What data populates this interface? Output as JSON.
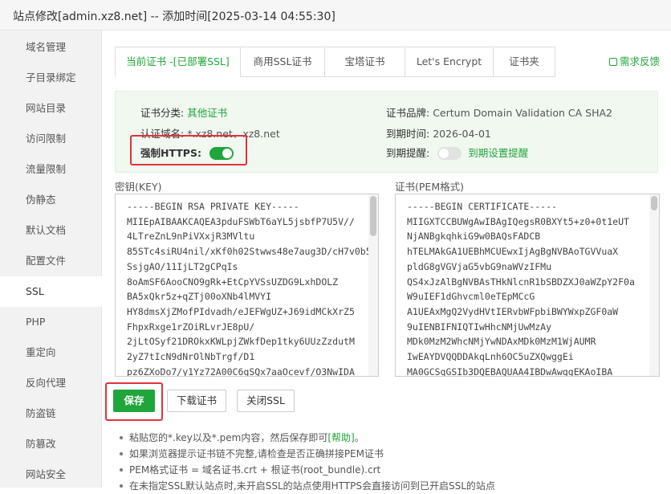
{
  "window": {
    "title": "站点修改[admin.xz8.net] -- 添加时间[2025-03-14 04:55:30]"
  },
  "sidebar": {
    "items": [
      {
        "label": "域名管理"
      },
      {
        "label": "子目录绑定"
      },
      {
        "label": "网站目录"
      },
      {
        "label": "访问限制"
      },
      {
        "label": "流量限制"
      },
      {
        "label": "伪静态"
      },
      {
        "label": "默认文档"
      },
      {
        "label": "配置文件"
      },
      {
        "label": "SSL",
        "active": true
      },
      {
        "label": "PHP"
      },
      {
        "label": "重定向"
      },
      {
        "label": "反向代理"
      },
      {
        "label": "防盗链"
      },
      {
        "label": "防篡改"
      },
      {
        "label": "网站安全"
      }
    ]
  },
  "tabs": [
    {
      "label": "当前证书 -[已部署SSL]",
      "active": true
    },
    {
      "label": "商用SSL证书"
    },
    {
      "label": "宝塔证书"
    },
    {
      "label": "Let's Encrypt"
    },
    {
      "label": "证书夹"
    }
  ],
  "feedback": {
    "label": "需求反馈",
    "icon": "feedback-icon"
  },
  "cert_info": {
    "category_label": "证书分类:",
    "category_value": "其他证书",
    "domain_label": "认证域名:",
    "domain_value": "*.xz8.net、xz8.net",
    "https_label": "强制HTTPS:",
    "https_enabled": true,
    "brand_label": "证书品牌:",
    "brand_value": "Certum Domain Validation CA SHA2",
    "expire_label": "到期时间:",
    "expire_value": "2026-04-01",
    "remind_label": "到期提醒:",
    "remind_enabled": false,
    "remind_link": "到期设置提醒"
  },
  "key_field": {
    "label": "密钥(KEY)",
    "value": "-----BEGIN RSA PRIVATE KEY-----\nMIIEpAIBAAKCAQEA3pduFSWbT6aYL5jsbfP7U5V//\n4LTreZnL9nPiVXxjR3MVltu\n85STc4siRU4nil/xKf0h02Stwws48e7aug3D/cH7v0b5\nSsjgAO/11IjLT2gCPqIs\n8oAmSF6AooCNO9gRk+EtCpYVSsUZDG9LxhDOLZ\nBA5xQkr5z+qZTj00oXNb4lMVYI\nHY8dmsXjZMofPIdvadh/eJEFWgUZ+J69idMCkXrZ5\nFhpxRxge1rZOiRLvrJE8pU/\n2jLtOSyf21DROkxKWLpjZWkfDep1tky6UUzZzdutM\n2yZ7tIcN9dNrOlNbTrgf/D1\npz6ZXoDo7/y1Yz72A00C6qSQx7aaOcevf/O3NwIDA"
  },
  "cert_field": {
    "label": "证书(PEM格式)",
    "value": "-----BEGIN CERTIFICATE-----\nMIIGXTCCBUWgAwIBAgIQegsR0BXYt5+z0+0t1eUT\nNjANBgkqhkiG9w0BAQsFADCB\nhTELMAkGA1UEBhMCUEwxIjAgBgNVBAoTGVVuaX\npldG8gVGVjaG5vbG9naWVzIFMu\nQS4xJzAlBgNVBAsTHkNlcnR1bSBDZXJ0aWZpY2F0a\nW9uIEF1dGhvcml0eTEpMCcG\nA1UEAxMgQ2VydHVtIERvbWFpbiBWYWxpZGF0aW\n9uIENBIFNIQTIwHhcNMjUwMzAy\nMDk0MzM2WhcNMjYwNDAxMDk0MzM1WjAUMR\nIwEAYDVQQDDAkqLnh6OC5uZXQwggEi\nMA0GCSqGSIb3DQEBAQUAA4IBDwAwggEKAoIBA"
  },
  "buttons": {
    "save": "保存",
    "download": "下载证书",
    "close_ssl": "关闭SSL"
  },
  "tips": {
    "tip1_text": "粘贴您的*.key以及*.pem内容，然后保存即可",
    "tip1_link": "[帮助]",
    "tip1_end": "。",
    "tip2": "如果浏览器提示证书链不完整,请检查是否正确拼接PEM证书",
    "tip3": "PEM格式证书 = 域名证书.crt + 根证书(root_bundle).crt",
    "tip4": "在未指定SSL默认站点时,未开启SSL的站点使用HTTPS会直接访问到已开启SSL的站点"
  },
  "colors": {
    "accent": "#20a53a",
    "highlight": "#e0333a"
  }
}
